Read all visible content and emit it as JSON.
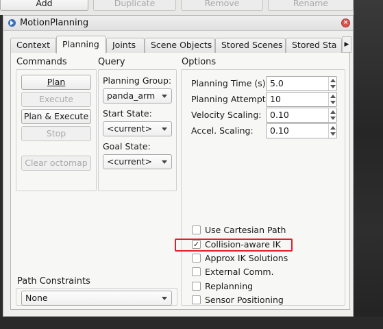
{
  "top_buttons": [
    {
      "label": "Add",
      "enabled": true
    },
    {
      "label": "Duplicate",
      "enabled": false
    },
    {
      "label": "Remove",
      "enabled": false
    },
    {
      "label": "Rename",
      "enabled": false
    }
  ],
  "panel": {
    "title": "MotionPlanning"
  },
  "tabs": [
    "Context",
    "Planning",
    "Joints",
    "Scene Objects",
    "Stored Scenes",
    "Stored Sta"
  ],
  "active_tab": "Planning",
  "commands": {
    "heading": "Commands",
    "plan": "Plan",
    "execute": "Execute",
    "plan_execute": "Plan & Execute",
    "stop": "Stop",
    "clear_octomap": "Clear octomap"
  },
  "query": {
    "heading": "Query",
    "planning_group_label": "Planning Group:",
    "planning_group_value": "panda_arm",
    "start_state_label": "Start State:",
    "start_state_value": "<current>",
    "goal_state_label": "Goal State:",
    "goal_state_value": "<current>"
  },
  "options": {
    "heading": "Options",
    "planning_time_label": "Planning Time (s):",
    "planning_time_value": "5.0",
    "planning_attempts_label": "Planning Attempts:",
    "planning_attempts_value": "10",
    "velocity_scaling_label": "Velocity Scaling:",
    "velocity_scaling_value": "0.10",
    "accel_scaling_label": "Accel. Scaling:",
    "accel_scaling_value": "0.10",
    "checkboxes": [
      {
        "label": "Use Cartesian Path",
        "checked": false
      },
      {
        "label": "Collision-aware IK",
        "checked": true
      },
      {
        "label": "Approx IK Solutions",
        "checked": false
      },
      {
        "label": "External Comm.",
        "checked": false
      },
      {
        "label": "Replanning",
        "checked": false
      },
      {
        "label": "Sensor Positioning",
        "checked": false
      }
    ]
  },
  "path_constraints": {
    "heading": "Path Constraints",
    "value": "None"
  },
  "colors": {
    "highlight": "#e0202a"
  }
}
